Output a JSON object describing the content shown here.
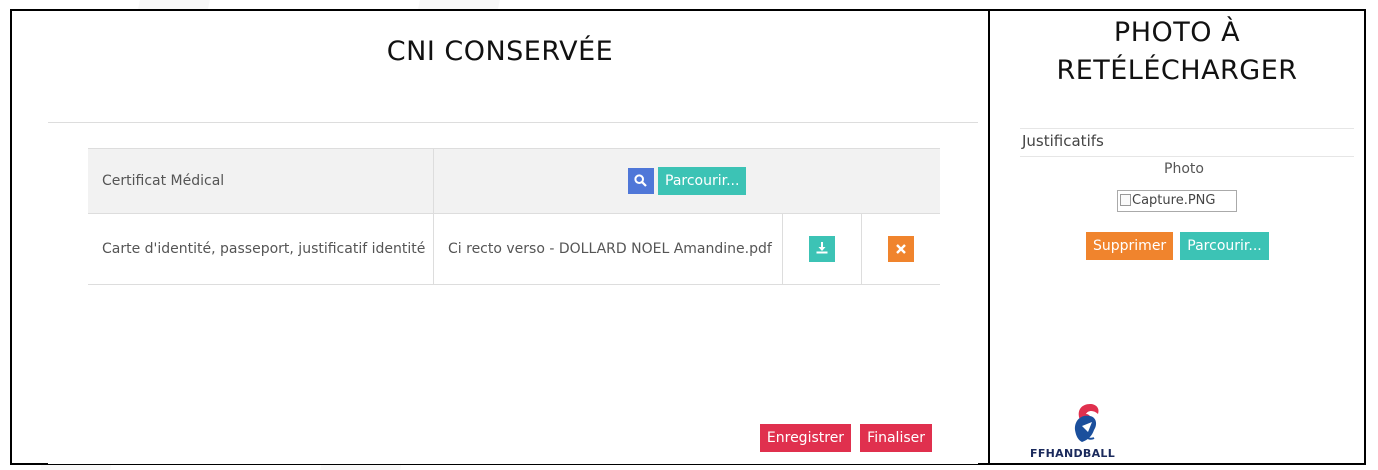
{
  "left": {
    "title": "CNI CONSERVÉE",
    "rows": [
      {
        "label": "Certificat Médical",
        "browse_label": "Parcourir..."
      },
      {
        "label": "Carte d'identité, passeport, justificatif identité",
        "file_name": "Ci recto verso - DOLLARD NOEL Amandine.pdf"
      }
    ],
    "save_label": "Enregistrer",
    "finalize_label": "Finaliser"
  },
  "right": {
    "title": "PHOTO À RETÉLÉCHARGER",
    "section_label": "Justificatifs",
    "photo_label": "Photo",
    "image_alt": "Capture.PNG",
    "delete_label": "Supprimer",
    "browse_label": "Parcourir...",
    "logo_text": "FFHANDBALL"
  },
  "icons": [
    "search-icon",
    "download-icon",
    "close-icon",
    "broken-image-icon",
    "ffhandball-logo"
  ],
  "colors": {
    "teal": "#3cc3b5",
    "blue": "#4f77d8",
    "orange": "#f0842d",
    "red": "#e0304e"
  }
}
